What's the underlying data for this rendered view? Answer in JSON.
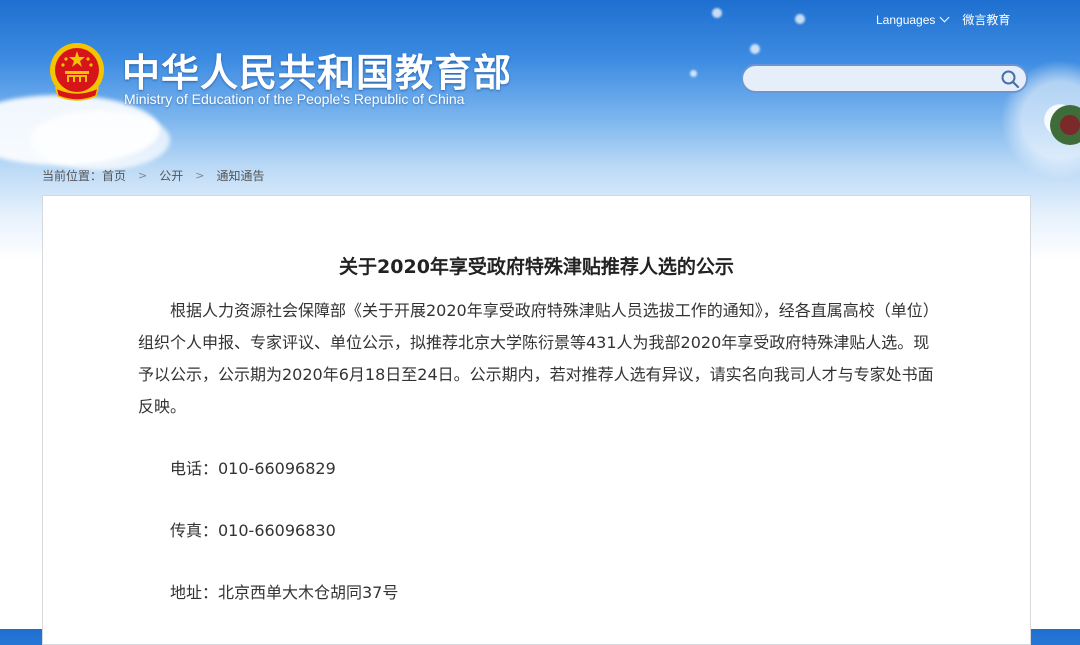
{
  "header": {
    "title_cn": "中华人民共和国教育部",
    "title_en": "Ministry of Education of the People's Republic of China",
    "languages_label": "Languages",
    "weibo_label": "微言教育",
    "search_placeholder": ""
  },
  "breadcrumb": {
    "prefix": "当前位置：",
    "items": [
      "首页",
      "公开",
      "通知通告"
    ]
  },
  "article": {
    "title": "关于2020年享受政府特殊津贴推荐人选的公示",
    "paragraph": "根据人力资源社会保障部《关于开展2020年享受政府特殊津贴人员选拔工作的通知》，经各直属高校（单位）组织个人申报、专家评议、单位公示，拟推荐北京大学陈衍景等431人为我部2020年享受政府特殊津贴人选。现予以公示，公示期为2020年6月18日至24日。公示期内，若对推荐人选有异议，请实名向我司人才与专家处书面反映。",
    "phone": "电话：010-66096829",
    "fax": "传真：010-66096830",
    "address": "地址：北京西单大木仓胡同37号"
  },
  "colors": {
    "header_blue": "#1e6fd0",
    "emblem_red": "#d7141a",
    "emblem_gold": "#f5c400"
  }
}
